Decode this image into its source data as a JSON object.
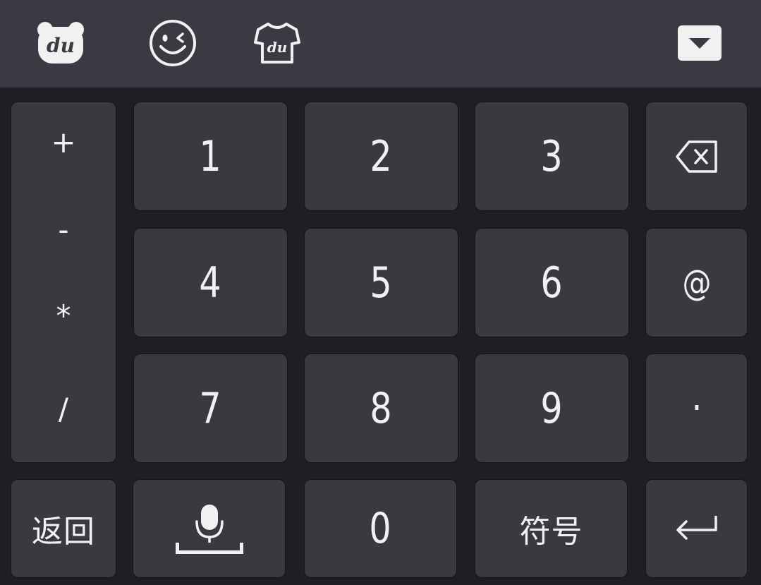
{
  "toolbar": {
    "icons": [
      {
        "name": "du-logo-icon",
        "text": "du"
      },
      {
        "name": "emoji-icon"
      },
      {
        "name": "skin-shirt-icon",
        "text": "du"
      },
      {
        "name": "collapse-keyboard-icon"
      }
    ]
  },
  "keypad": {
    "symbols": [
      "+",
      "-",
      "*",
      "/"
    ],
    "digits": [
      "1",
      "2",
      "3",
      "4",
      "5",
      "6",
      "7",
      "8",
      "9",
      "0"
    ],
    "at": "@",
    "dot": "·",
    "back_label": "返回",
    "symbols_label": "符号"
  },
  "colors": {
    "background": "#1d1f25",
    "toolbar": "#3a3b42",
    "key": "#393a40",
    "glyph": "#f1f1f1"
  }
}
